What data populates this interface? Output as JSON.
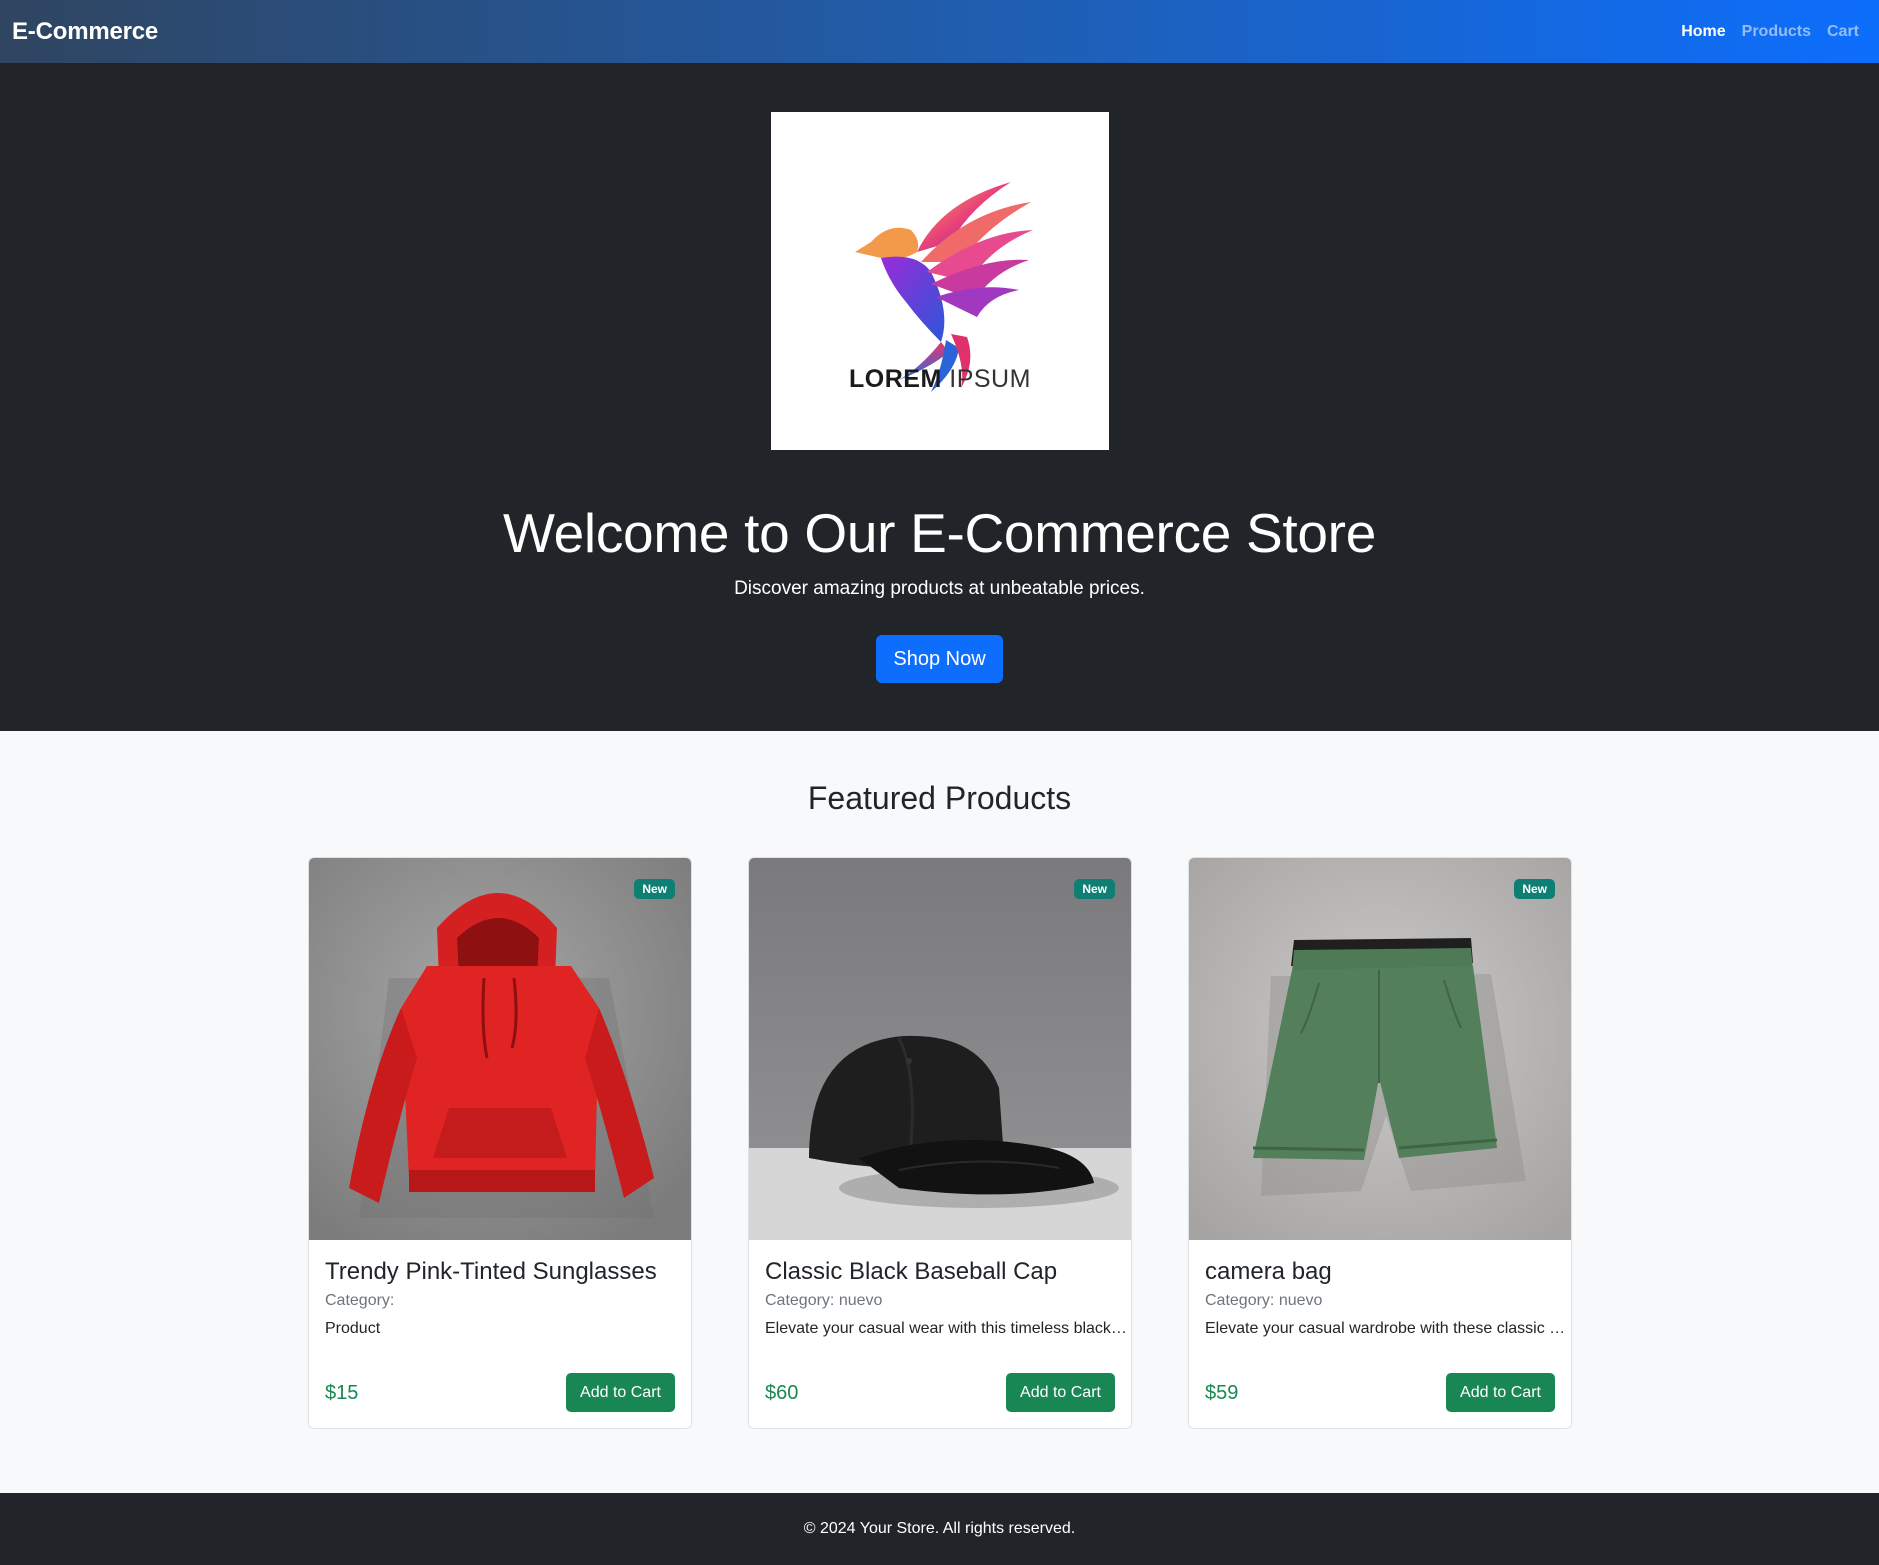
{
  "navbar": {
    "brand": "E-Commerce",
    "links": [
      {
        "label": "Home",
        "active": true
      },
      {
        "label": "Products",
        "active": false
      },
      {
        "label": "Cart",
        "active": false
      }
    ]
  },
  "hero": {
    "logo_text_bold": "LOREM",
    "logo_text_light": "IPSUM",
    "title": "Welcome to Our E-Commerce Store",
    "subtitle": "Discover amazing products at unbeatable prices.",
    "cta": "Shop Now"
  },
  "featured": {
    "title": "Featured Products",
    "products": [
      {
        "image": "red-hoodie",
        "badge": "New",
        "name": "Trendy Pink-Tinted Sunglasses",
        "category": "Category:",
        "description": "Product",
        "price": "$15",
        "button": "Add to Cart"
      },
      {
        "image": "black-baseball-cap",
        "badge": "New",
        "name": "Classic Black Baseball Cap",
        "category": "Category: nuevo",
        "description": "Elevate your casual wear with this timeless black ba...",
        "price": "$60",
        "button": "Add to Cart"
      },
      {
        "image": "green-shorts",
        "badge": "New",
        "name": "camera bag",
        "category": "Category: nuevo",
        "description": "Elevate your casual wardrobe with these classic oliv...",
        "price": "$59",
        "button": "Add to Cart"
      }
    ]
  },
  "footer": {
    "text": "© 2024 Your Store. All rights reserved."
  },
  "colors": {
    "primary": "#0d6efd",
    "success": "#198754",
    "dark": "#212529",
    "badge": "#0f7f74"
  }
}
